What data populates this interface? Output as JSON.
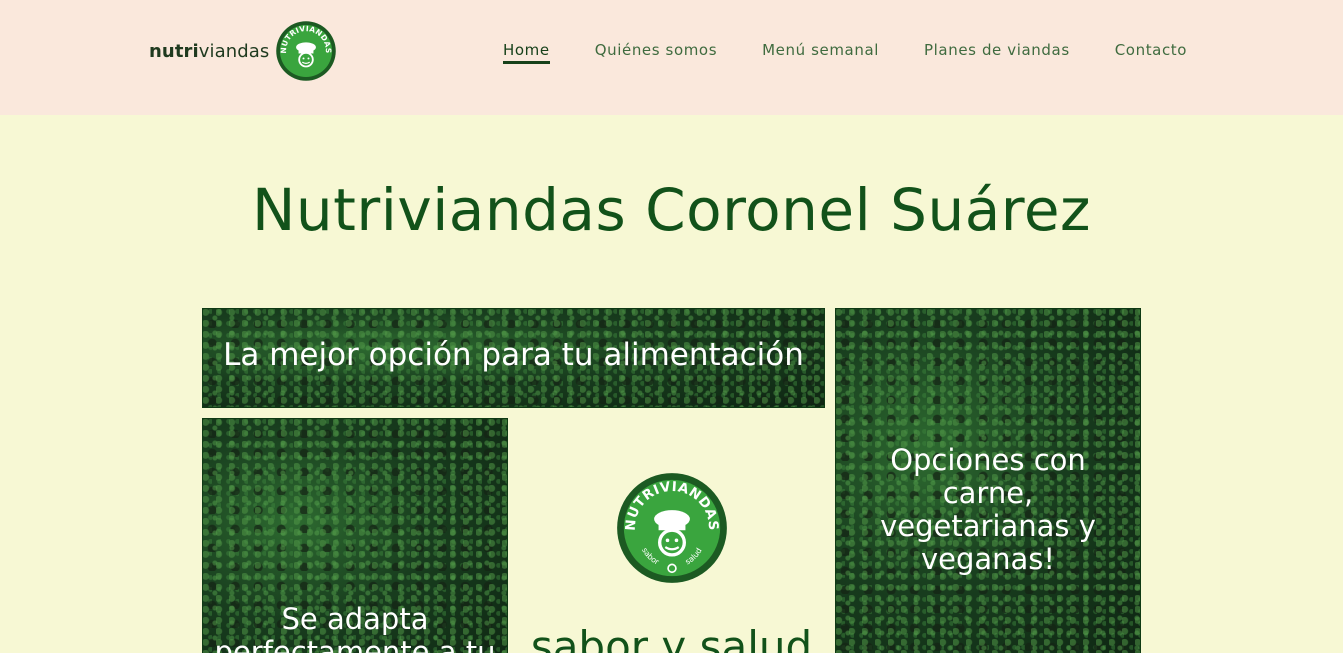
{
  "header": {
    "brand": {
      "bold": "nutri",
      "regular": "viandas",
      "logo": "nutriviandas-logo-icon"
    },
    "nav": [
      {
        "label": "Home",
        "active": true
      },
      {
        "label": "Quiénes somos",
        "active": false
      },
      {
        "label": "Menú semanal",
        "active": false
      },
      {
        "label": "Planes de viandas",
        "active": false
      },
      {
        "label": "Contacto",
        "active": false
      }
    ]
  },
  "main": {
    "title": "Nutriviandas Coronel Suárez",
    "tiles": {
      "best_option": "La mejor opción para tu alimentación",
      "options": "Opciones con carne, vegetarianas y veganas!",
      "adapts": "Se adapta perfectamente a tu"
    },
    "logo": {
      "top_text": "NUTRIVIANDAS",
      "left_text": "sabor",
      "right_text": "salud"
    },
    "slogan": "sabor y salud"
  },
  "colors": {
    "header_bg": "#fae8dc",
    "page_bg": "#f7f8d4",
    "brand_green": "#12521a",
    "logo_green": "#3aa53e"
  }
}
